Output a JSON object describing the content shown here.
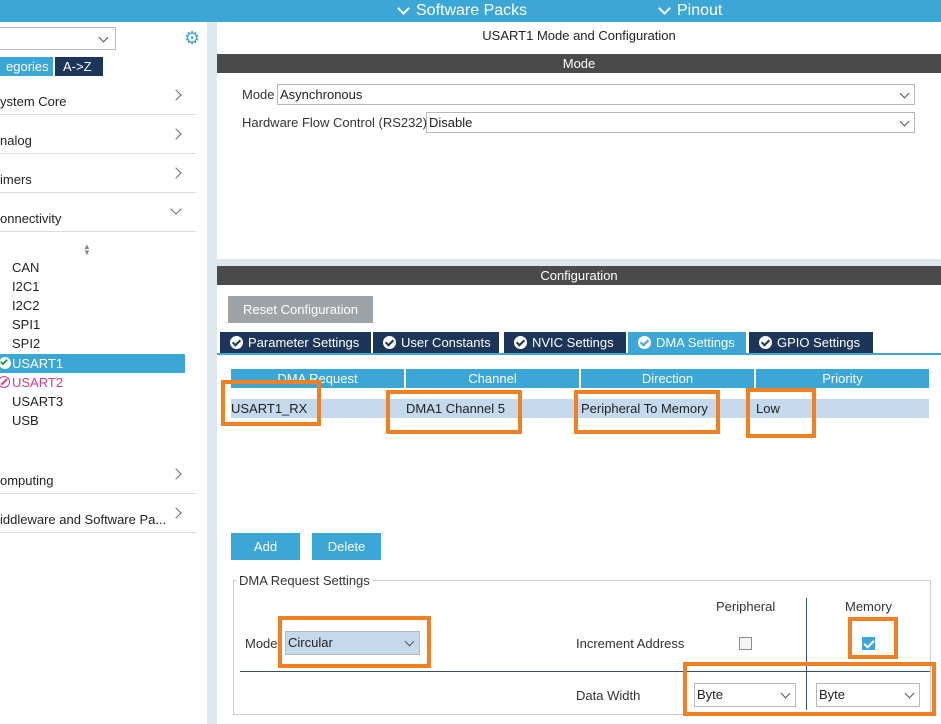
{
  "topbar": {
    "software_packs": "Software Packs",
    "pinout": "Pinout"
  },
  "left": {
    "tab_categories": "egories",
    "tab_az": "A->Z",
    "categories": [
      {
        "label": "ystem Core",
        "expanded": false
      },
      {
        "label": "nalog",
        "expanded": false
      },
      {
        "label": "imers",
        "expanded": false
      },
      {
        "label": "onnectivity",
        "expanded": true
      },
      {
        "label": "omputing",
        "expanded": false
      },
      {
        "label": "iddleware and Software Pa...",
        "expanded": false
      }
    ],
    "peripherals": [
      "CAN",
      "I2C1",
      "I2C2",
      "SPI1",
      "SPI2",
      "USART1",
      "USART2",
      "USART3",
      "USB"
    ],
    "selected": "USART1"
  },
  "main": {
    "title": "USART1 Mode and Configuration",
    "mode_section": "Mode",
    "mode_label": "Mode",
    "mode_value": "Asynchronous",
    "flow_label": "Hardware Flow Control (RS232)",
    "flow_value": "Disable",
    "config_section": "Configuration",
    "reset_button": "Reset Configuration",
    "tabs": [
      {
        "label": "Parameter Settings",
        "active": false
      },
      {
        "label": "User Constants",
        "active": false
      },
      {
        "label": "NVIC Settings",
        "active": false
      },
      {
        "label": "DMA Settings",
        "active": true
      },
      {
        "label": "GPIO Settings",
        "active": false
      }
    ],
    "table": {
      "headers": [
        "DMA Request",
        "Channel",
        "Direction",
        "Priority"
      ],
      "rows": [
        [
          "USART1_RX",
          "DMA1 Channel 5",
          "Peripheral To Memory",
          "Low"
        ]
      ]
    },
    "add_button": "Add",
    "delete_button": "Delete",
    "dma_settings": {
      "legend": "DMA Request Settings",
      "peripheral_header": "Peripheral",
      "memory_header": "Memory",
      "mode_label": "Mode",
      "mode_value": "Circular",
      "increment_label": "Increment Address",
      "peripheral_increment": false,
      "memory_increment": true,
      "data_width_label": "Data Width",
      "peripheral_width": "Byte",
      "memory_width": "Byte"
    }
  },
  "colors": {
    "accent": "#3ca7d6",
    "dark_tab": "#1c3559",
    "highlight": "#f08020",
    "section_bar": "#4a4a4a",
    "error": "#d63c8c",
    "ok": "#2ea043"
  }
}
